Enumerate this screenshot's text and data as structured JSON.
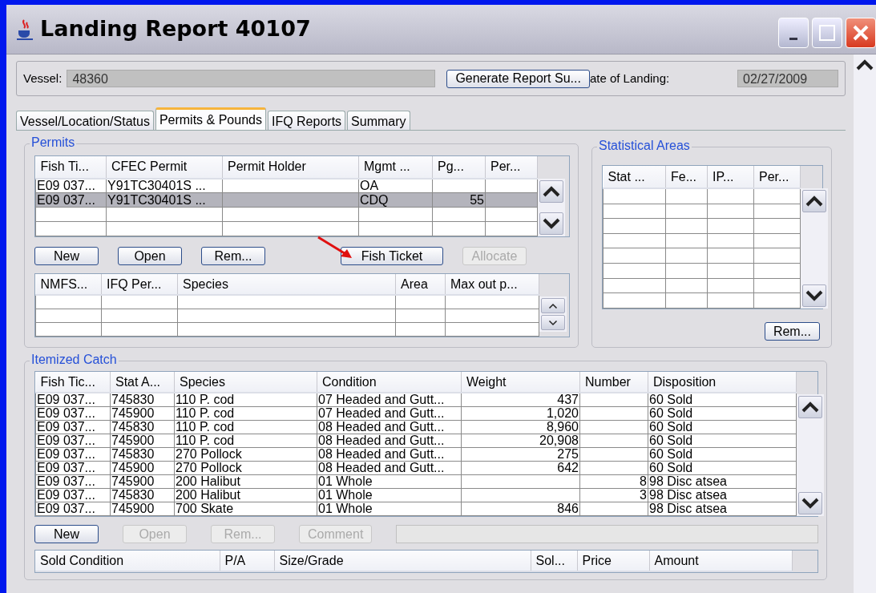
{
  "window": {
    "title": "Landing Report 40107"
  },
  "vessel": {
    "label": "Vessel:",
    "value": "48360"
  },
  "generate_button": {
    "label": "Generate Report Su..."
  },
  "date_of_landing": {
    "label": "ate of Landing:",
    "value": "02/27/2009"
  },
  "tabs": [
    {
      "label": "Vessel/Location/Status",
      "selected": false
    },
    {
      "label": "Permits & Pounds",
      "selected": true
    },
    {
      "label": "IFQ Reports",
      "selected": false
    },
    {
      "label": "Summary",
      "selected": false
    }
  ],
  "permits": {
    "title": "Permits",
    "table": {
      "columns": [
        "Fish Ti...",
        "CFEC Permit",
        "Permit Holder",
        "Mgmt ...",
        "Pg...",
        "Per..."
      ],
      "rows": [
        {
          "cells": [
            "E09 037...",
            "Y91TC30401S ...",
            null,
            "OA",
            null,
            null
          ],
          "selected": false
        },
        {
          "cells": [
            "E09 037...",
            "Y91TC30401S ...",
            null,
            "CDQ",
            "55",
            null
          ],
          "selected": true
        }
      ]
    },
    "buttons": [
      {
        "label": "New",
        "disabled": false
      },
      {
        "label": "Open",
        "disabled": false
      },
      {
        "label": "Rem...",
        "disabled": false
      },
      {
        "label": "Fish Ticket",
        "disabled": false
      },
      {
        "label": "Allocate",
        "disabled": true
      }
    ],
    "ifq_table": {
      "columns": [
        "NMFS...",
        "IFQ Per...",
        "Species",
        "Area",
        "Max out p..."
      ]
    }
  },
  "statistical_areas": {
    "title": "Statistical Areas",
    "table": {
      "columns": [
        "Stat ...",
        "Fe...",
        "IP...",
        "Per..."
      ]
    },
    "buttons": [
      {
        "label": "Rem...",
        "disabled": false
      }
    ]
  },
  "itemized_catch": {
    "title": "Itemized Catch",
    "table": {
      "columns": [
        "Fish Tic...",
        "Stat A...",
        "Species",
        "Condition",
        "Weight",
        "Number",
        "Disposition"
      ],
      "rows": [
        [
          "E09 037...",
          "745830",
          "110 P. cod",
          "07 Headed and Gutt...",
          "437",
          null,
          "60 Sold"
        ],
        [
          "E09 037...",
          "745900",
          "110 P. cod",
          "07 Headed and Gutt...",
          "1,020",
          null,
          "60 Sold"
        ],
        [
          "E09 037...",
          "745830",
          "110 P. cod",
          "08 Headed and Gutt...",
          "8,960",
          null,
          "60 Sold"
        ],
        [
          "E09 037...",
          "745900",
          "110 P. cod",
          "08 Headed and Gutt...",
          "20,908",
          null,
          "60 Sold"
        ],
        [
          "E09 037...",
          "745830",
          "270 Pollock",
          "08 Headed and Gutt...",
          "275",
          null,
          "60 Sold"
        ],
        [
          "E09 037...",
          "745900",
          "270 Pollock",
          "08 Headed and Gutt...",
          "642",
          null,
          "60 Sold"
        ],
        [
          "E09 037...",
          "745900",
          "200 Halibut",
          "01 Whole",
          null,
          "8",
          "98 Disc atsea"
        ],
        [
          "E09 037...",
          "745830",
          "200 Halibut",
          "01 Whole",
          null,
          "3",
          "98 Disc atsea"
        ],
        [
          "E09 037...",
          "745900",
          "700 Skate",
          "01 Whole",
          "846",
          null,
          "98 Disc atsea"
        ]
      ]
    },
    "buttons": [
      {
        "label": "New",
        "disabled": false
      },
      {
        "label": "Open",
        "disabled": true
      },
      {
        "label": "Rem...",
        "disabled": true
      },
      {
        "label": "Comment",
        "disabled": true
      }
    ],
    "comment_field": {
      "disabled": true
    },
    "sold_table": {
      "columns": [
        "Sold Condition",
        "P/A",
        "Size/Grade",
        "Sol...",
        "Price",
        "Amount"
      ]
    }
  }
}
